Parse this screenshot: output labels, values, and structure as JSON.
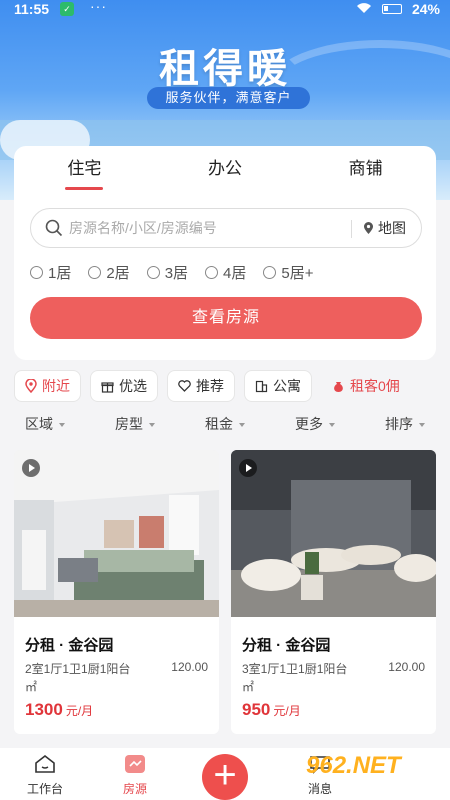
{
  "status": {
    "time": "11:55",
    "battery": "24%"
  },
  "brand": {
    "logo": "租得暖",
    "slogan": "服务伙伴，满意客户"
  },
  "tabs": [
    {
      "label": "住宅",
      "active": true
    },
    {
      "label": "办公",
      "active": false
    },
    {
      "label": "商铺",
      "active": false
    }
  ],
  "search": {
    "placeholder": "房源名称/小区/房源编号",
    "map_label": "地图"
  },
  "rooms": [
    "1居",
    "2居",
    "3居",
    "4居",
    "5居+"
  ],
  "query_button": "查看房源",
  "chips": [
    {
      "label": "附近",
      "icon": "location-icon"
    },
    {
      "label": "优选",
      "icon": "gift-icon"
    },
    {
      "label": "推荐",
      "icon": "heart-icon"
    },
    {
      "label": "公寓",
      "icon": "building-icon"
    },
    {
      "label": "租客0佣",
      "icon": "money-bag-icon"
    }
  ],
  "sort": [
    "区域",
    "房型",
    "租金",
    "更多",
    "排序"
  ],
  "listings": [
    {
      "title": "分租 · 金谷园",
      "desc": "2室1厅1卫1厨1阳台",
      "area": "120.00",
      "unit": "㎡",
      "price": "1300",
      "price_unit": "元/月"
    },
    {
      "title": "分租 · 金谷园",
      "desc": "3室1厅1卫1厨1阳台",
      "area": "120.00",
      "unit": "㎡",
      "price": "950",
      "price_unit": "元/月"
    }
  ],
  "bottom_nav": [
    {
      "label": "工作台",
      "active": false
    },
    {
      "label": "房源",
      "active": true
    },
    {
      "label": "消息",
      "active": false
    }
  ],
  "watermark": "962.NET"
}
